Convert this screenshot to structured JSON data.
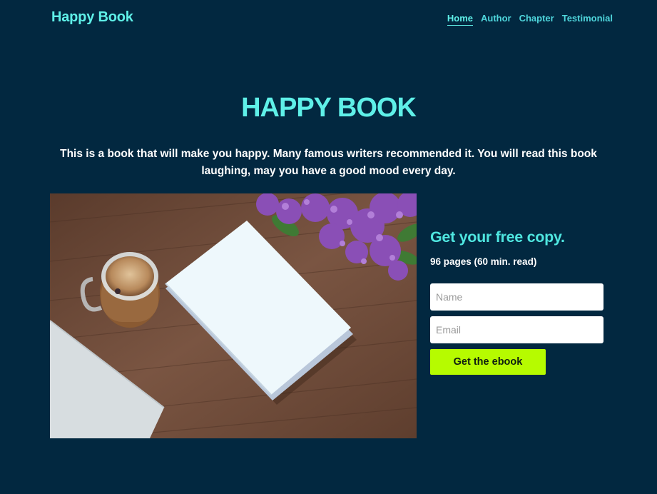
{
  "header": {
    "logo": "Happy Book",
    "nav": [
      {
        "label": "Home",
        "active": true
      },
      {
        "label": "Author",
        "active": false
      },
      {
        "label": "Chapter",
        "active": false
      },
      {
        "label": "Testimonial",
        "active": false
      }
    ]
  },
  "hero": {
    "title": "HAPPY BOOK",
    "description": "This is a book that will make you happy. Many famous writers recommended it. You will read this book laughing, may you have a good mood every day."
  },
  "signup": {
    "title": "Get your free copy.",
    "meta": "96 pages (60 min. read)",
    "name_placeholder": "Name",
    "email_placeholder": "Email",
    "button_label": "Get the ebook"
  },
  "colors": {
    "background": "#022840",
    "accent": "#5ff0e8",
    "button": "#b6fb00"
  }
}
